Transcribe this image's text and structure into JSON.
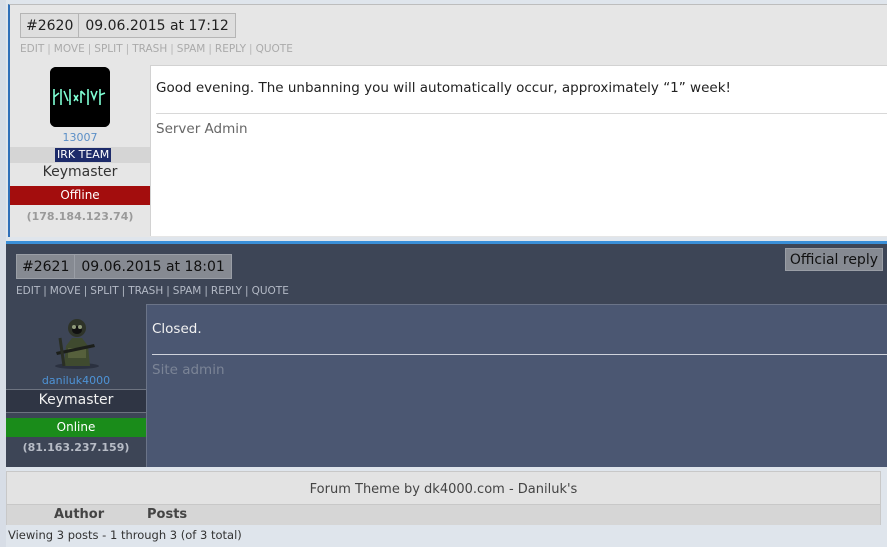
{
  "posts": [
    {
      "number": "#2620",
      "datetime": "09.06.2015 at 17:12",
      "actions": [
        "EDIT",
        "MOVE",
        "SPLIT",
        "TRASH",
        "SPAM",
        "REPLY",
        "QUOTE"
      ],
      "author": {
        "avatar_icon": "rune-logo-avatar",
        "user_id": "13007",
        "team_badge": "IRK TEAM",
        "role": "Keymaster",
        "status": "Offline",
        "status_color": "#a30d0d",
        "ip": "(178.184.123.74)"
      },
      "message": "Good evening. The unbanning you will automatically occur, approximately “1” week!",
      "signature": "Server Admin"
    },
    {
      "number": "#2621",
      "datetime": "09.06.2015 at 18:01",
      "official_label": "Official reply",
      "actions": [
        "EDIT",
        "MOVE",
        "SPLIT",
        "TRASH",
        "SPAM",
        "REPLY",
        "QUOTE"
      ],
      "author": {
        "avatar_icon": "soldier-avatar",
        "username": "daniluk4000",
        "role": "Keymaster",
        "status": "Online",
        "status_color": "#1a8c1a",
        "ip": "(81.163.237.159)"
      },
      "message": "Closed.",
      "signature": "Site admin"
    }
  ],
  "footer": {
    "theme_credit": "Forum Theme by dk4000.com - Daniluk's",
    "columns": [
      "Author",
      "Posts"
    ],
    "viewing": "Viewing 3 posts - 1 through 3 (of 3 total)"
  },
  "colors": {
    "accent": "#3a8fd8",
    "dark_post_bg": "#3d4556",
    "dark_content_bg": "#4b5772"
  }
}
